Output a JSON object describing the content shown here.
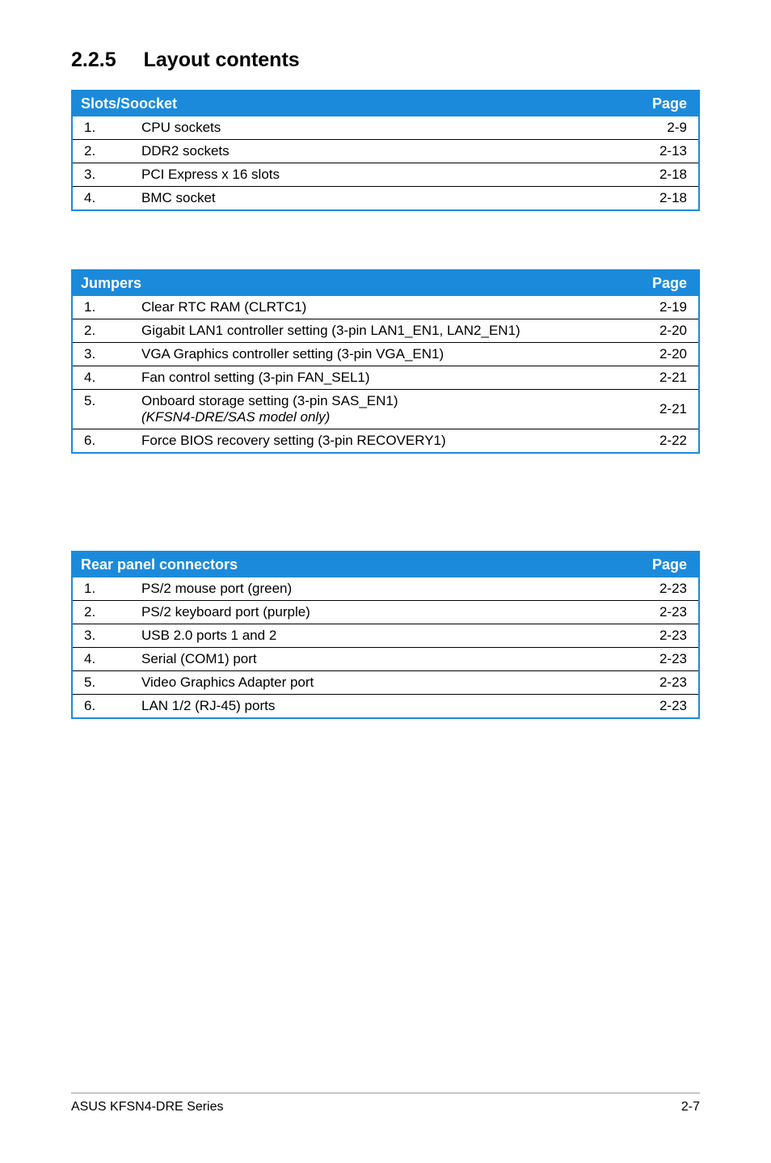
{
  "heading": {
    "number": "2.2.5",
    "title": "Layout contents"
  },
  "tables": {
    "slots": {
      "header_left": "Slots/Soocket",
      "header_right": "Page",
      "rows": [
        {
          "idx": "1.",
          "name": "CPU sockets",
          "page": "2-9"
        },
        {
          "idx": "2.",
          "name": "DDR2 sockets",
          "page": "2-13"
        },
        {
          "idx": "3.",
          "name": "PCI Express x 16 slots",
          "page": "2-18"
        },
        {
          "idx": "4.",
          "name": "BMC socket",
          "page": "2-18"
        }
      ]
    },
    "jumpers": {
      "header_left": "Jumpers",
      "header_right": "Page",
      "rows": [
        {
          "idx": "1.",
          "name": "Clear RTC RAM (CLRTC1)",
          "page": "2-19"
        },
        {
          "idx": "2.",
          "name": "Gigabit LAN1 controller setting (3-pin LAN1_EN1, LAN2_EN1)",
          "page": "2-20"
        },
        {
          "idx": "3.",
          "name": "VGA Graphics controller setting (3-pin VGA_EN1)",
          "page": "2-20"
        },
        {
          "idx": "4.",
          "name": "Fan control setting (3-pin FAN_SEL1)",
          "page": "2-21"
        },
        {
          "idx": "5.",
          "name": "Onboard storage setting (3-pin SAS_EN1)",
          "note": "(KFSN4-DRE/SAS model only)",
          "page": "2-21"
        },
        {
          "idx": "6.",
          "name": "Force BIOS recovery setting (3-pin RECOVERY1)",
          "page": "2-22"
        }
      ]
    },
    "rear": {
      "header_left": "Rear panel connectors",
      "header_right": "Page",
      "rows": [
        {
          "idx": "1.",
          "name": "PS/2 mouse port (green)",
          "page": "2-23"
        },
        {
          "idx": "2.",
          "name": "PS/2 keyboard port (purple)",
          "page": "2-23"
        },
        {
          "idx": "3.",
          "name": "USB 2.0 ports 1 and 2",
          "page": "2-23"
        },
        {
          "idx": "4.",
          "name": "Serial (COM1) port",
          "page": "2-23"
        },
        {
          "idx": "5.",
          "name": "Video Graphics Adapter port",
          "page": "2-23"
        },
        {
          "idx": "6.",
          "name": "LAN 1/2 (RJ-45) ports",
          "page": "2-23"
        }
      ]
    }
  },
  "footer": {
    "left": "ASUS KFSN4-DRE Series",
    "right": "2-7"
  }
}
